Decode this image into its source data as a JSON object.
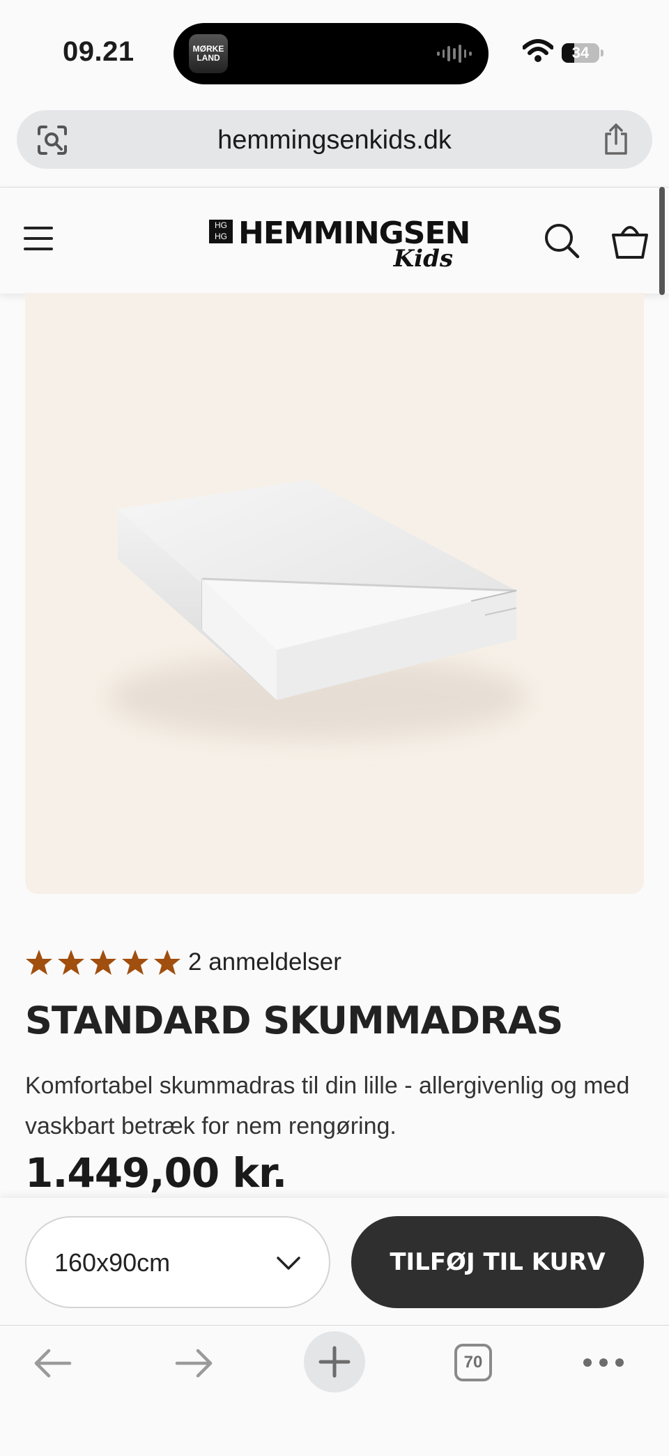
{
  "status_bar": {
    "time": "09.21",
    "island_app_label": "MØRKE LAND",
    "battery": "34",
    "battery_level": 0.34
  },
  "browser": {
    "url": "hemmingsenkids.dk",
    "tabs_count": "70"
  },
  "site_header": {
    "brand": "HEMMINGSEN",
    "brand_sub": "Kids"
  },
  "product": {
    "rating": 5,
    "reviews_label": "2 anmeldelser",
    "title": "STANDARD SKUMMADRAS",
    "description": "Komfortabel skummadras til din lille - allergivenlig og med vaskbart betræk for nem rengøring.",
    "price": "1.449,00 kr.",
    "size_selected": "160x90cm",
    "add_to_cart_label": "TILFØJ TIL KURV"
  },
  "colors": {
    "accent_star": "#a04f0f",
    "button_dark": "#2f2f2f",
    "image_bg": "#f7f0e8"
  }
}
